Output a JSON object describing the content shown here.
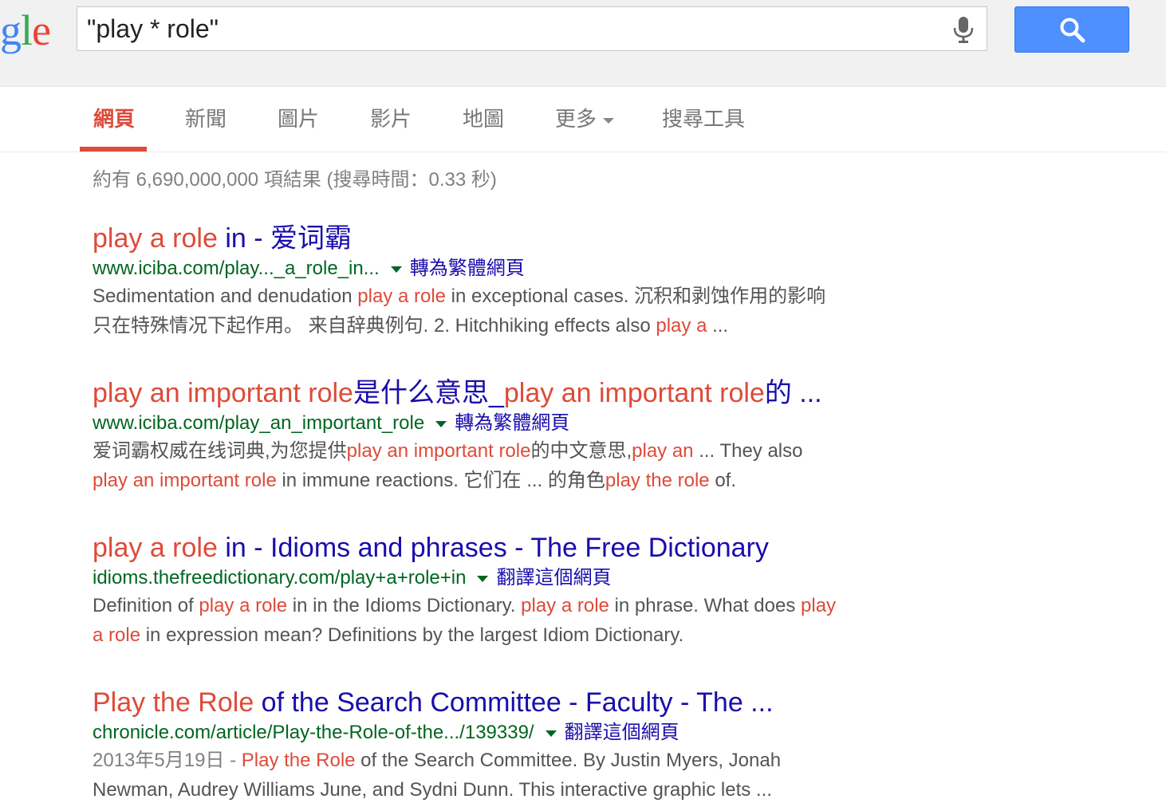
{
  "logo": {
    "g": "g",
    "l": "l",
    "e": "e"
  },
  "search": {
    "query": "\"play * role\""
  },
  "tabs": [
    "網頁",
    "新聞",
    "圖片",
    "影片",
    "地圖",
    "更多",
    "搜尋工具"
  ],
  "stats": "約有 6,690,000,000 項結果 (搜尋時間：0.33 秒)",
  "results": [
    {
      "title": [
        [
          "play a role",
          "hl"
        ],
        [
          " in - 爱词霸",
          ""
        ]
      ],
      "url": "www.iciba.com/play..._a_role_in...",
      "translate": "轉為繁體網頁",
      "snippet": [
        [
          [
            "Sedimentation and denudation ",
            ""
          ],
          [
            "play a role",
            "hl"
          ],
          [
            " in exceptional cases. 沉积和剥蚀作用的影响",
            ""
          ]
        ],
        [
          [
            "只在特殊情况下起作用。 来自辞典例句. 2. Hitchhiking effects also ",
            ""
          ],
          [
            "play a",
            "hl"
          ],
          [
            " ...",
            ""
          ]
        ]
      ]
    },
    {
      "title": [
        [
          "play an important role",
          "hl"
        ],
        [
          "是什么意思_",
          ""
        ],
        [
          "play an important role",
          "hl"
        ],
        [
          "的 ...",
          ""
        ]
      ],
      "url": "www.iciba.com/play_an_important_role",
      "translate": "轉為繁體網頁",
      "snippet": [
        [
          [
            "爱词霸权威在线词典,为您提供",
            ""
          ],
          [
            "play an important role",
            "hl"
          ],
          [
            "的中文意思,",
            ""
          ],
          [
            "play an",
            "hl"
          ],
          [
            " ... They also",
            ""
          ]
        ],
        [
          [
            "play an important role",
            "hl"
          ],
          [
            " in immune reactions. 它们在 ... 的角色",
            ""
          ],
          [
            "play the role",
            "hl"
          ],
          [
            " of.",
            ""
          ]
        ]
      ]
    },
    {
      "title": [
        [
          "play a role",
          "hl"
        ],
        [
          " in - Idioms and phrases - The Free Dictionary",
          ""
        ]
      ],
      "url": "idioms.thefreedictionary.com/play+a+role+in",
      "translate": "翻譯這個網頁",
      "snippet": [
        [
          [
            "Definition of ",
            ""
          ],
          [
            "play a role",
            "hl"
          ],
          [
            " in in the Idioms Dictionary. ",
            ""
          ],
          [
            "play a role",
            "hl"
          ],
          [
            " in phrase. What does ",
            ""
          ],
          [
            "play",
            "hl"
          ]
        ],
        [
          [
            "a role",
            "hl"
          ],
          [
            " in expression mean? Definitions by the largest Idiom Dictionary.",
            ""
          ]
        ]
      ]
    },
    {
      "title": [
        [
          "Play the Role",
          "hl"
        ],
        [
          " of the Search Committee - Faculty - The ...",
          ""
        ]
      ],
      "url": "chronicle.com/article/Play-the-Role-of-the.../139339/",
      "translate": "翻譯這個網頁",
      "snippet": [
        [
          [
            "2013年5月19日 - ",
            "date"
          ],
          [
            "Play the Role",
            "hl"
          ],
          [
            " of the Search Committee. By Justin Myers, Jonah",
            ""
          ]
        ],
        [
          [
            "Newman, Audrey Williams June, and Sydni Dunn. This interactive graphic lets ...",
            ""
          ]
        ]
      ]
    }
  ],
  "colors": {
    "accent": "#dd4b39",
    "link": "#1a0dab",
    "url": "#006621",
    "button": "#4d90fe"
  },
  "icons": {
    "mic": "microphone-icon",
    "search": "magnifier-icon",
    "dropdown": "caret-down-icon"
  }
}
